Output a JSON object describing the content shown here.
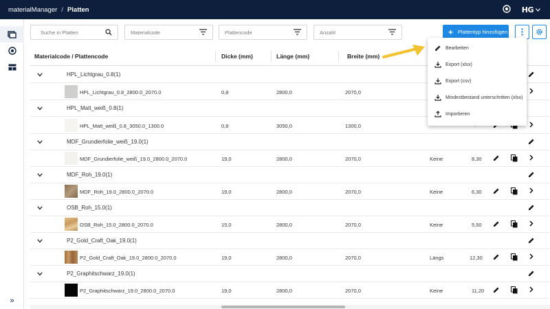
{
  "header": {
    "app": "materialManager",
    "separator": "/",
    "page": "Platten",
    "logo": "HG"
  },
  "toolbar": {
    "search_placeholder": "Suche in Platten",
    "filter_materialcode": "Materialcode",
    "filter_plattencode": "Plattencode",
    "filter_anzahl": "Anzahl",
    "add_button": "Plattentyp hinzufügen",
    "accent": "#1e88e5"
  },
  "columns": {
    "code": "Materialcode / Plattencode",
    "dicke": "Dicke (mm)",
    "laenge": "Länge (mm)",
    "breite": "Breite (mm)"
  },
  "menu": {
    "edit": "Bearbeiten",
    "export_xlsx": "Export (xlsx)",
    "export_csv": "Export (csv)",
    "mindest": "Mindestbestand unterschritten (xlsx)",
    "import": "Importieren"
  },
  "groups": [
    {
      "name": "HPL_Lichtgrau_0.8(1)",
      "item": {
        "code": "HPL_Lichtgrau_0.8_2800.0_2070.0",
        "dicke": "0,8",
        "laenge": "2800,0",
        "breite": "2070,0",
        "maserung": "",
        "preis": "",
        "thumb": "#cfcfcd"
      }
    },
    {
      "name": "HPL_Matt_weiß_0.8(1)",
      "item": {
        "code": "HPL_Matt_weiß_0.8_3050.0_1300.0",
        "dicke": "0,8",
        "laenge": "3050,0",
        "breite": "1300,0",
        "maserung": "",
        "preis": "",
        "thumb": "#f6f4f1"
      }
    },
    {
      "name": "MDF_Grundierfolie_weiß_19.0(1)",
      "item": {
        "code": "MDF_Grundierfolie_weiß_19.0_2800.0_2070.0",
        "dicke": "19,0",
        "laenge": "2800,0",
        "breite": "2070,0",
        "maserung": "Keine",
        "preis": "8,30",
        "thumb": "#f4f2ef"
      }
    },
    {
      "name": "MDF_Roh_19.0(1)",
      "item": {
        "code": "MDF_Roh_19.0_2800.0_2070.0",
        "dicke": "19,0",
        "laenge": "2800,0",
        "breite": "2070,0",
        "maserung": "Keine",
        "preis": "6,30",
        "thumb": "#9c8266"
      }
    },
    {
      "name": "OSB_Roh_15.0(1)",
      "item": {
        "code": "OSB_Roh_15.0_2800.0_2070.0",
        "dicke": "15,0",
        "laenge": "2800,0",
        "breite": "2070,0",
        "maserung": "Keine",
        "preis": "5,50",
        "thumb": "#d9b584"
      }
    },
    {
      "name": "P2_Gold_Craft_Oak_19.0(1)",
      "item": {
        "code": "P2_Gold_Craft_Oak_19.0_2800.0_2070.0",
        "dicke": "19,0",
        "laenge": "2800,0",
        "breite": "2070,0",
        "maserung": "Längs",
        "preis": "12,30",
        "thumb": "#b08050"
      }
    },
    {
      "name": "P2_Graphitschwarz_19.0(1)",
      "item": {
        "code": "P2_Graphitschwarz_19.0_2800.0_2070.0",
        "dicke": "19,0",
        "laenge": "2800,0",
        "breite": "2070,0",
        "maserung": "Keine",
        "preis": "11,20",
        "thumb": "#050505"
      }
    }
  ],
  "partial": {
    "row0_price": "",
    "row1_price": "1,50"
  },
  "icons": [
    "user-icon",
    "hg-logo",
    "sidebar-boards-icon",
    "sidebar-rolls-icon",
    "sidebar-storage-icon",
    "expand-sidebar-icon",
    "search-icon",
    "filter-icon",
    "plus-icon",
    "more-vert-icon",
    "gear-icon",
    "chevron-down-icon",
    "edit-icon",
    "copy-icon",
    "chevron-right-icon",
    "download-icon",
    "upload-icon",
    "arrow-icon"
  ]
}
